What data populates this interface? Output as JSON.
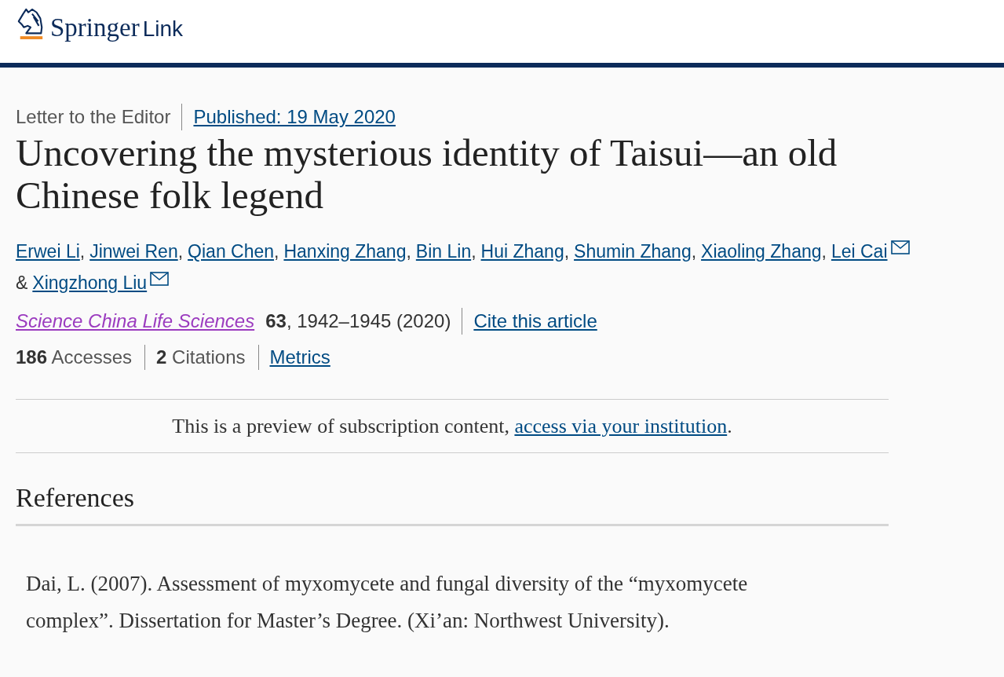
{
  "header": {
    "logo_text": "Springer",
    "logo_suffix": "Link"
  },
  "article": {
    "type": "Letter to the Editor",
    "published": "Published: 19 May 2020",
    "title": "Uncovering the mysterious identity of Taisui—an old Chinese folk legend",
    "authors": [
      {
        "name": "Erwei Li",
        "email": false
      },
      {
        "name": "Jinwei Ren",
        "email": false
      },
      {
        "name": "Qian Chen",
        "email": false
      },
      {
        "name": "Hanxing Zhang",
        "email": false
      },
      {
        "name": "Bin Lin",
        "email": false
      },
      {
        "name": "Hui Zhang",
        "email": false
      },
      {
        "name": "Shumin Zhang",
        "email": false
      },
      {
        "name": "Xiaoling Zhang",
        "email": false
      },
      {
        "name": "Lei Cai",
        "email": true
      },
      {
        "name": "Xingzhong Liu",
        "email": true
      }
    ],
    "author_joiner": "&",
    "author_separator": ",",
    "journal": {
      "name": "Science China Life Sciences",
      "volume": "63",
      "details": ", 1942–1945 (2020)",
      "cite": "Cite this article"
    },
    "metrics": [
      "**186** Accesses",
      "**2** Citations"
    ],
    "metrics_link": "Metrics"
  },
  "preview": {
    "text": "This is a preview of subscription content, ",
    "link": "access via your institution",
    "end": "."
  },
  "references": {
    "heading": "References",
    "items": [
      "Dai, L. (2007). Assessment of myxomycete and fungal diversity of the “myxomycete complex”. Dissertation for Master’s Degree. (Xi’an: Northwest University)."
    ]
  }
}
